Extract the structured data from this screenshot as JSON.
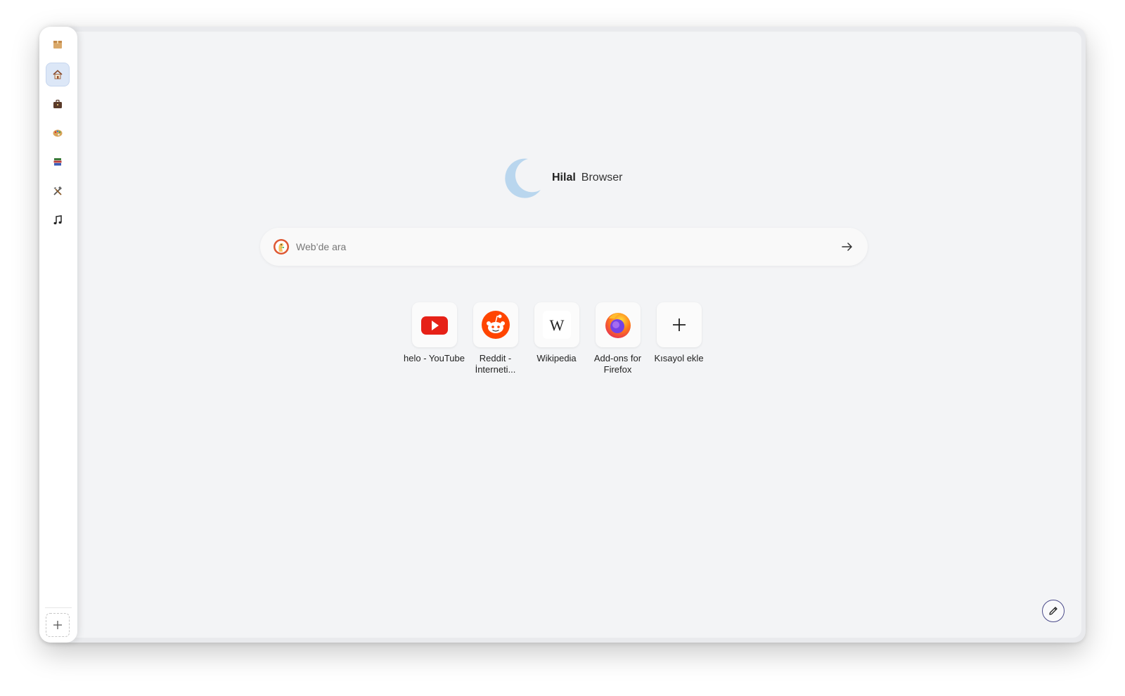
{
  "sidebar": {
    "workspaces": [
      {
        "icon": "box-icon",
        "active": false
      },
      {
        "icon": "house-icon",
        "active": true
      },
      {
        "icon": "briefcase-icon",
        "active": false
      },
      {
        "icon": "palette-icon",
        "active": false
      },
      {
        "icon": "books-icon",
        "active": false
      },
      {
        "icon": "tools-icon",
        "active": false
      },
      {
        "icon": "music-note-icon",
        "active": false
      }
    ],
    "add_icon": "plus-icon"
  },
  "brand": {
    "name_bold": "Hilal",
    "name_light": "Browser",
    "logo_icon": "crescent-moon-icon",
    "logo_color": "#b9d6ee"
  },
  "search": {
    "placeholder": "Web’de ara",
    "value": "",
    "engine_icon": "duckduckgo-icon",
    "submit_icon": "arrow-right-icon"
  },
  "shortcuts": [
    {
      "label": "helo - YouTube",
      "icon": "youtube-icon"
    },
    {
      "label": "Reddit - İnterneti...",
      "icon": "reddit-icon"
    },
    {
      "label": "Wikipedia",
      "icon": "wikipedia-icon"
    },
    {
      "label": "Add-ons for Firefox",
      "icon": "firefox-icon"
    },
    {
      "label": "Kısayol ekle",
      "icon": "plus-icon"
    }
  ],
  "edit_icon": "pencil-icon",
  "colors": {
    "youtube": "#e62117",
    "reddit": "#ff4500",
    "accent_active": "#dce7f7",
    "edit_border": "#4b4b8a"
  }
}
